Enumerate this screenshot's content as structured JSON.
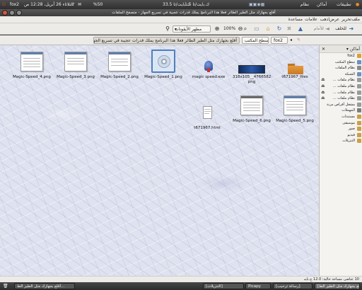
{
  "top_panel": {
    "menus": [
      "تطبيقات",
      "أماكن",
      "نظام"
    ],
    "network_down": "1.5 ك.بايت/ثا",
    "network_up": "33.5 ك.بايت/ثا",
    "battery": "%50",
    "clock": "الثلاثاء 26 أبريل، 12:28 ص",
    "user": "fox2"
  },
  "window": {
    "title": "أقلع بجهازك مثل الطير الطائر فعلا هذا البرنامج يملك قدرات عجيبة في تسريع الجهاز - متصفح الملفات"
  },
  "menubar": [
    "ملف",
    "تحرير",
    "عرض",
    "اذهب",
    "علامات",
    "مساعدة"
  ],
  "toolbar": {
    "back": "للخلف",
    "forward": "للأمام",
    "zoom": "100%",
    "view_mode": "مطهر الأيقونات"
  },
  "location": {
    "active_crumb": "أقلع بجهازك مثل الطير الطائر فعلا هذا البرنامج يملك قدرات عجيبة في تسريع الجهاز",
    "crumbs": [
      "سطح المكتب",
      "fox2"
    ]
  },
  "files": [
    {
      "name": "Magic-Speed_4.png",
      "kind": "shot"
    },
    {
      "name": "Magic-Speed_3.png",
      "kind": "shot"
    },
    {
      "name": "Magic-Speed_2.png",
      "kind": "shot"
    },
    {
      "name": "Magic-Speed_1.png",
      "kind": "disc"
    },
    {
      "name": "magic speed.exe",
      "kind": "exe"
    },
    {
      "name": "318x105__4766582\npng",
      "kind": "banner"
    },
    {
      "name": "t671967_files",
      "kind": "folder"
    },
    {
      "name": "t671967.html",
      "kind": "html"
    },
    {
      "name": "Magic-Speed_6.png",
      "kind": "shot"
    },
    {
      "name": "Magic-Speed_5.png",
      "kind": "shot"
    }
  ],
  "sidebar": {
    "header": "أماكن",
    "items": [
      {
        "label": "fox2",
        "color": "#d9a13b",
        "eject": false
      },
      {
        "label": "سطح المكتب",
        "color": "#6f8fc0",
        "eject": false
      },
      {
        "label": "نظام الملفات",
        "color": "#8a8a8a",
        "eject": false
      },
      {
        "label": "الشبكة",
        "color": "#6f8fc0",
        "eject": false
      },
      {
        "label": "نظام ملفات ...",
        "color": "#9a9a9a",
        "eject": true
      },
      {
        "label": "نظام ملفات ...",
        "color": "#9a9a9a",
        "eject": true
      },
      {
        "label": "نظام ملفات ...",
        "color": "#9a9a9a",
        "eject": true
      },
      {
        "label": "نظام ملفات ...",
        "color": "#9a9a9a",
        "eject": true
      },
      {
        "label": "مشغل أقراص مرنة",
        "color": "#9a9a9a",
        "eject": false
      },
      {
        "label": "المهملات",
        "color": "#7d7d7d",
        "eject": false
      },
      {
        "label": "مستندات",
        "color": "#c9a04a",
        "eject": false
      },
      {
        "label": "موسيقى",
        "color": "#c9a04a",
        "eject": false
      },
      {
        "label": "صور",
        "color": "#c9a04a",
        "eject": false
      },
      {
        "label": "فيديو",
        "color": "#c9a04a",
        "eject": false
      },
      {
        "label": "التنزيلات",
        "color": "#c9a04a",
        "eject": false
      }
    ]
  },
  "statusbar": {
    "text": "10 عناصر، مساحة خالية: 12.0 ج.بايت"
  },
  "taskbar": {
    "items": [
      "أقلع بجهازك مثل الطير الط...",
      "[التنزيلات]",
      "Picapy",
      "[رسالة ترحيب]",
      "[أقلع بجهازك مثل الطير الط...]"
    ]
  }
}
